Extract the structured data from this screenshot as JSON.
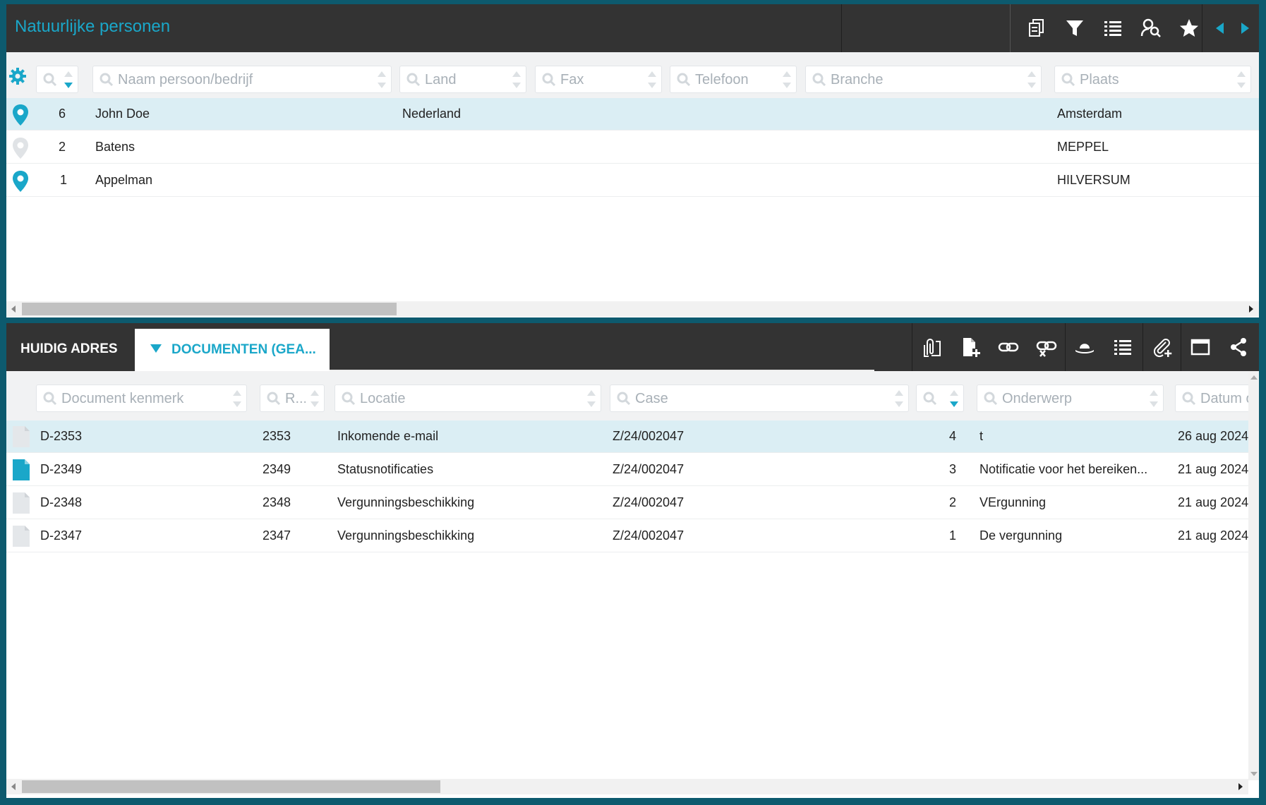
{
  "top": {
    "title": "Natuurlijke personen",
    "toolbar": {
      "copy": "copy-icon",
      "filter": "filter-icon",
      "list": "list-icon",
      "person_search": "person-search-icon",
      "favorite": "star-icon",
      "prev": "arrow-left-icon",
      "next": "arrow-right-icon"
    },
    "filters": {
      "naam": "Naam persoon/bedrijf",
      "land": "Land",
      "fax": "Fax",
      "telefoon": "Telefoon",
      "branche": "Branche",
      "plaats": "Plaats"
    },
    "rows": [
      {
        "id": "6",
        "naam": "John Doe",
        "land": "Nederland",
        "plaats": "Amsterdam",
        "pin": "active"
      },
      {
        "id": "2",
        "naam": "Batens",
        "land": "",
        "plaats": "MEPPEL",
        "pin": "inactive"
      },
      {
        "id": "1",
        "naam": "Appelman",
        "land": "",
        "plaats": "HILVERSUM",
        "pin": "active"
      }
    ]
  },
  "bottom": {
    "tabs": {
      "huidig_adres": "HUIDIG ADRES",
      "documenten": "DOCUMENTEN (GEA..."
    },
    "toolbar": [
      "attachments-icon",
      "add-document-icon",
      "link-icon",
      "unlink-icon",
      "hat-icon",
      "list-icon",
      "attach-add-icon",
      "window-icon",
      "share-icon"
    ],
    "filters": {
      "kenmerk": "Document kenmerk",
      "r": "R...",
      "locatie": "Locatie",
      "case": "Case",
      "onderwerp": "Onderwerp",
      "datum": "Datum o"
    },
    "rows": [
      {
        "kenmerk": "D-2353",
        "r": "2353",
        "locatie": "Inkomende e-mail",
        "case": "Z/24/002047",
        "nr": "4",
        "onderwerp": "t",
        "datum": "26 aug 2024"
      },
      {
        "kenmerk": "D-2349",
        "r": "2349",
        "locatie": "Statusnotificaties",
        "case": "Z/24/002047",
        "nr": "3",
        "onderwerp": "Notificatie voor het bereiken...",
        "datum": "21 aug 2024"
      },
      {
        "kenmerk": "D-2348",
        "r": "2348",
        "locatie": "Vergunningsbeschikking",
        "case": "Z/24/002047",
        "nr": "2",
        "onderwerp": "VErgunning",
        "datum": "21 aug 2024"
      },
      {
        "kenmerk": "D-2347",
        "r": "2347",
        "locatie": "Vergunningsbeschikking",
        "case": "Z/24/002047",
        "nr": "1",
        "onderwerp": "De vergunning",
        "datum": "21 aug 2024"
      }
    ]
  },
  "colors": {
    "accent": "#1aa7c9",
    "header": "#333333",
    "frame": "#0d5a6e",
    "selected_row": "#dbeef4"
  }
}
